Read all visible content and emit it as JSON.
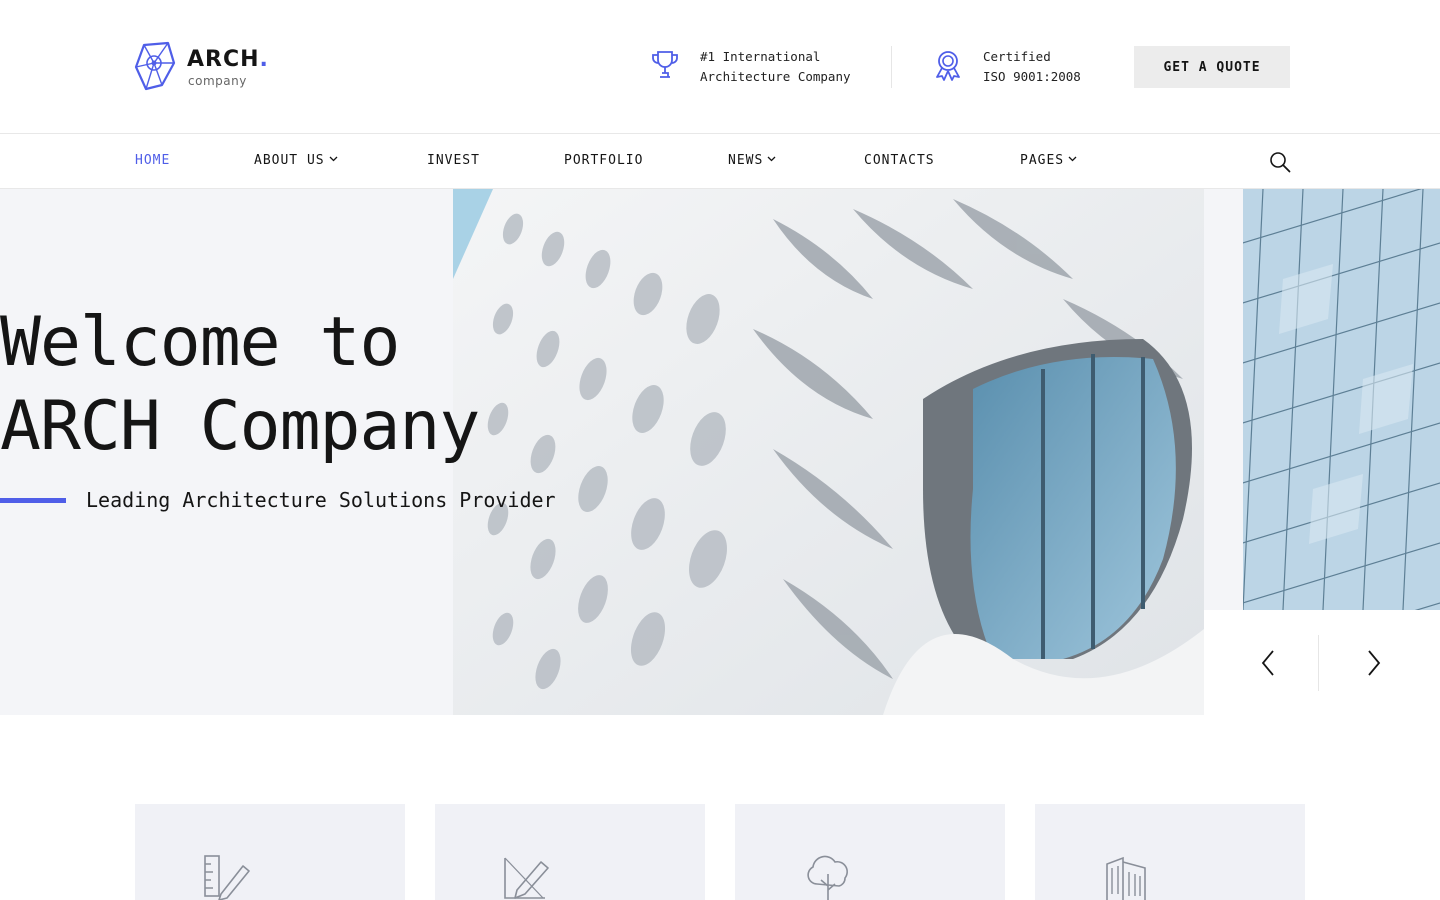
{
  "brand": {
    "name": "ARCH",
    "dot": ".",
    "sub": "company",
    "accent": "#4f5ee8"
  },
  "header": {
    "award": {
      "line1": "#1 International",
      "line2": "Architecture Company",
      "icon": "trophy-icon"
    },
    "cert": {
      "line1": "Certified",
      "line2": "ISO 9001:2008",
      "icon": "award-ribbon-icon"
    },
    "cta": "GET A QUOTE"
  },
  "nav": {
    "items": [
      {
        "label": "HOME",
        "active": true,
        "dropdown": false
      },
      {
        "label": "ABOUT US",
        "active": false,
        "dropdown": true
      },
      {
        "label": "INVEST",
        "active": false,
        "dropdown": false
      },
      {
        "label": "PORTFOLIO",
        "active": false,
        "dropdown": false
      },
      {
        "label": "NEWS",
        "active": false,
        "dropdown": true
      },
      {
        "label": "CONTACTS",
        "active": false,
        "dropdown": false
      },
      {
        "label": "PAGES",
        "active": false,
        "dropdown": true
      }
    ],
    "search_icon": "search-icon"
  },
  "hero": {
    "title": "Welcome to\nARCH Company",
    "subtitle": "Leading Architecture Solutions Provider"
  },
  "features": [
    {
      "icon": "pencil-ruler-icon"
    },
    {
      "icon": "pencil-draw-icon"
    },
    {
      "icon": "tree-icon"
    },
    {
      "icon": "building-icon"
    }
  ]
}
